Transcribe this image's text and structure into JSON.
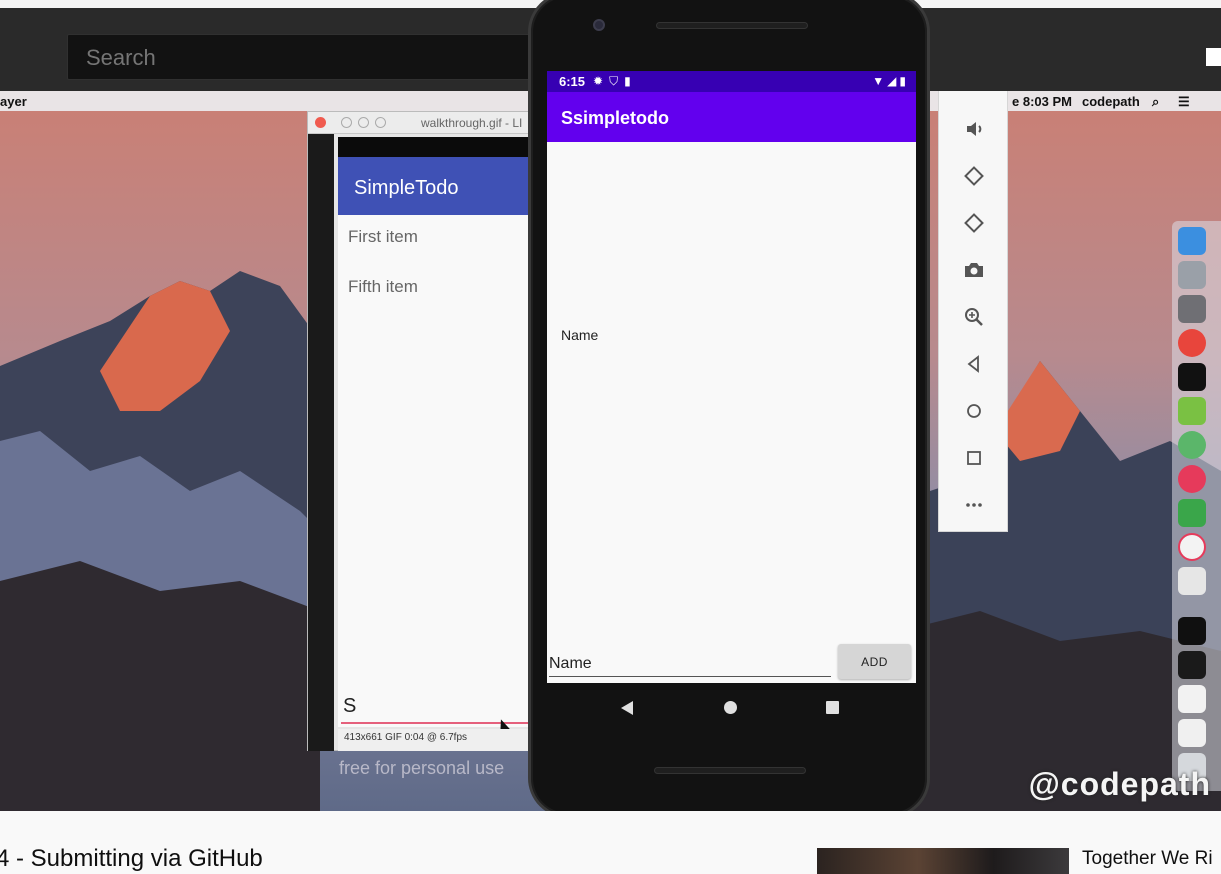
{
  "youtube": {
    "search_placeholder": "Search",
    "video_title": "4 - Submitting via GitHub",
    "recommended_title": "Together We Ri"
  },
  "video": {
    "watermark": "@codepath",
    "free_text": "free for personal use",
    "mac_menubar": {
      "app_name": "ayer",
      "time": "e 8:03 PM",
      "user": "codepath"
    },
    "gif_viewer": {
      "title": "walkthrough.gif - LI",
      "app_title": "SimpleTodo",
      "items": [
        "First item",
        "Fifth item"
      ],
      "input_value": "S",
      "footer": "413x661 GIF 0:04 @ 6.7fps"
    }
  },
  "emulator": {
    "status_time": "6:15",
    "app_title": "Ssimpletodo",
    "list_item": "Name",
    "input_placeholder": "Name",
    "add_label": "ADD",
    "toolbar": [
      "power-icon",
      "volume-up-icon",
      "volume-down-icon",
      "rotate-left-icon",
      "rotate-right-icon",
      "camera-icon",
      "zoom-icon",
      "back-icon",
      "home-icon",
      "overview-icon",
      "more-icon"
    ]
  },
  "colors": {
    "status_bar": "#3700b3",
    "app_bar": "#6200ee",
    "gif_app_bar": "#3f51b5",
    "gif_input_line": "#e5607c"
  }
}
